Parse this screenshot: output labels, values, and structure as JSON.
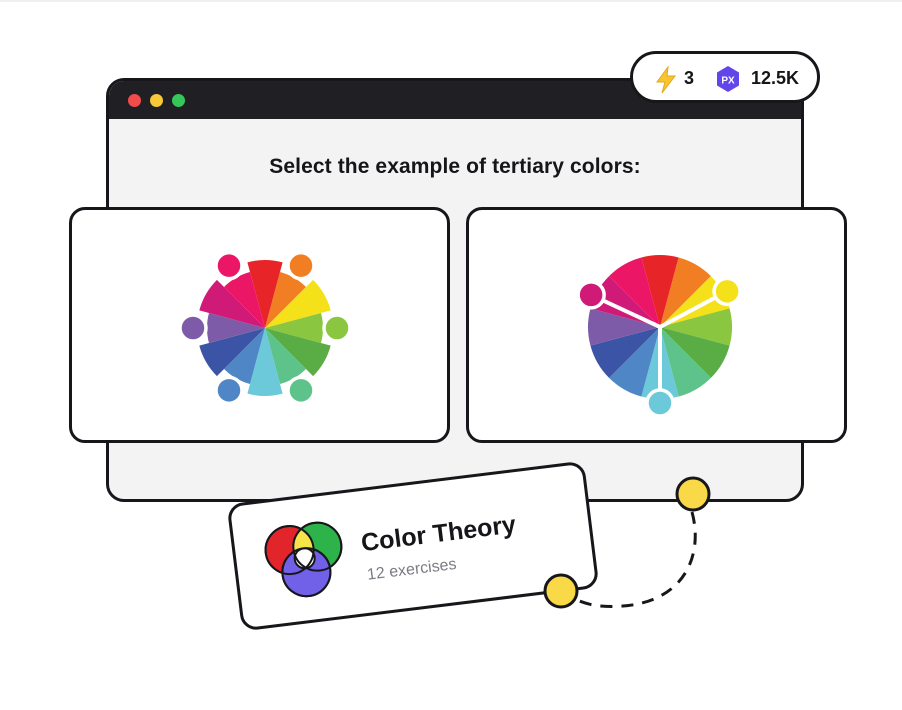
{
  "window": {
    "controls": [
      "close",
      "minimize",
      "maximize"
    ],
    "question": "Select the example of tertiary colors:"
  },
  "stats": {
    "streak_icon": "lightning-bolt-icon",
    "streak_count": "3",
    "xp_badge": "PX",
    "xp_amount": "12.5K"
  },
  "options": [
    {
      "name": "option-wheel-evenly-spaced",
      "selected": false
    },
    {
      "name": "option-wheel-clustered",
      "selected": false
    }
  ],
  "course": {
    "icon": "venn-diagram-icon",
    "title": "Color Theory",
    "subtitle": "12 exercises"
  },
  "colors": {
    "wheel": [
      "#e72529",
      "#f17e22",
      "#f4e11a",
      "#8ac63f",
      "#5aac44",
      "#5ec38a",
      "#6cc9da",
      "#4f86c6",
      "#3c54a5",
      "#7e5ba8",
      "#d01a78",
      "#ec1667"
    ],
    "accent_yellow": "#f9d947",
    "outline": "#17171b"
  }
}
